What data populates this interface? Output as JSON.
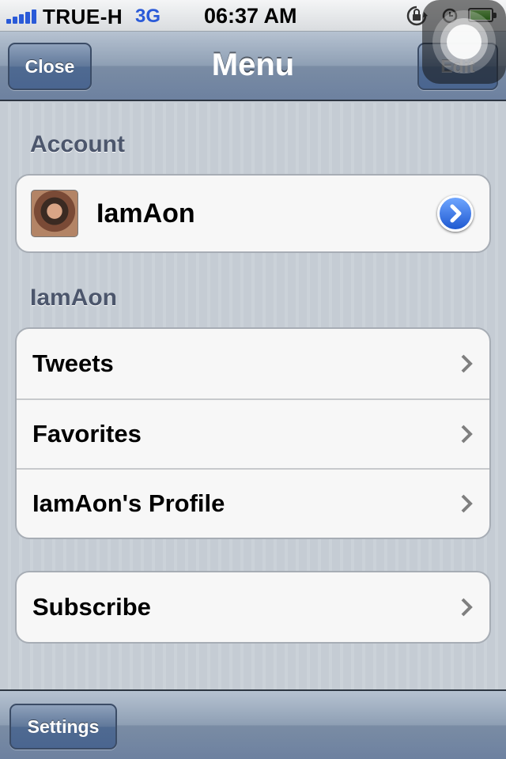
{
  "status_bar": {
    "carrier": "TRUE-H",
    "network": "3G",
    "time": "06:37 AM",
    "signal_bars": 5,
    "battery_level": 0.9
  },
  "nav": {
    "title": "Menu",
    "left_button": "Close",
    "right_button": "Edit"
  },
  "sections": {
    "account": {
      "header": "Account",
      "name": "IamAon"
    },
    "user": {
      "header": "IamAon",
      "items": [
        {
          "label": "Tweets"
        },
        {
          "label": "Favorites"
        },
        {
          "label": "IamAon's Profile"
        }
      ]
    },
    "extra": {
      "items": [
        {
          "label": "Subscribe"
        }
      ]
    }
  },
  "toolbar": {
    "settings_label": "Settings"
  },
  "colors": {
    "nav_bar": "#7a8ca4",
    "accent_blue": "#2a5ad8",
    "section_header": "#4c566c"
  },
  "icons": {
    "signal": "signal-bars-icon",
    "lock_rotation": "rotation-lock-icon",
    "alarm": "alarm-clock-icon",
    "battery": "battery-icon",
    "disclosure": "blue-disclosure-arrow-icon",
    "chevron": "chevron-right-icon",
    "assistive_touch": "assistive-touch-icon"
  }
}
